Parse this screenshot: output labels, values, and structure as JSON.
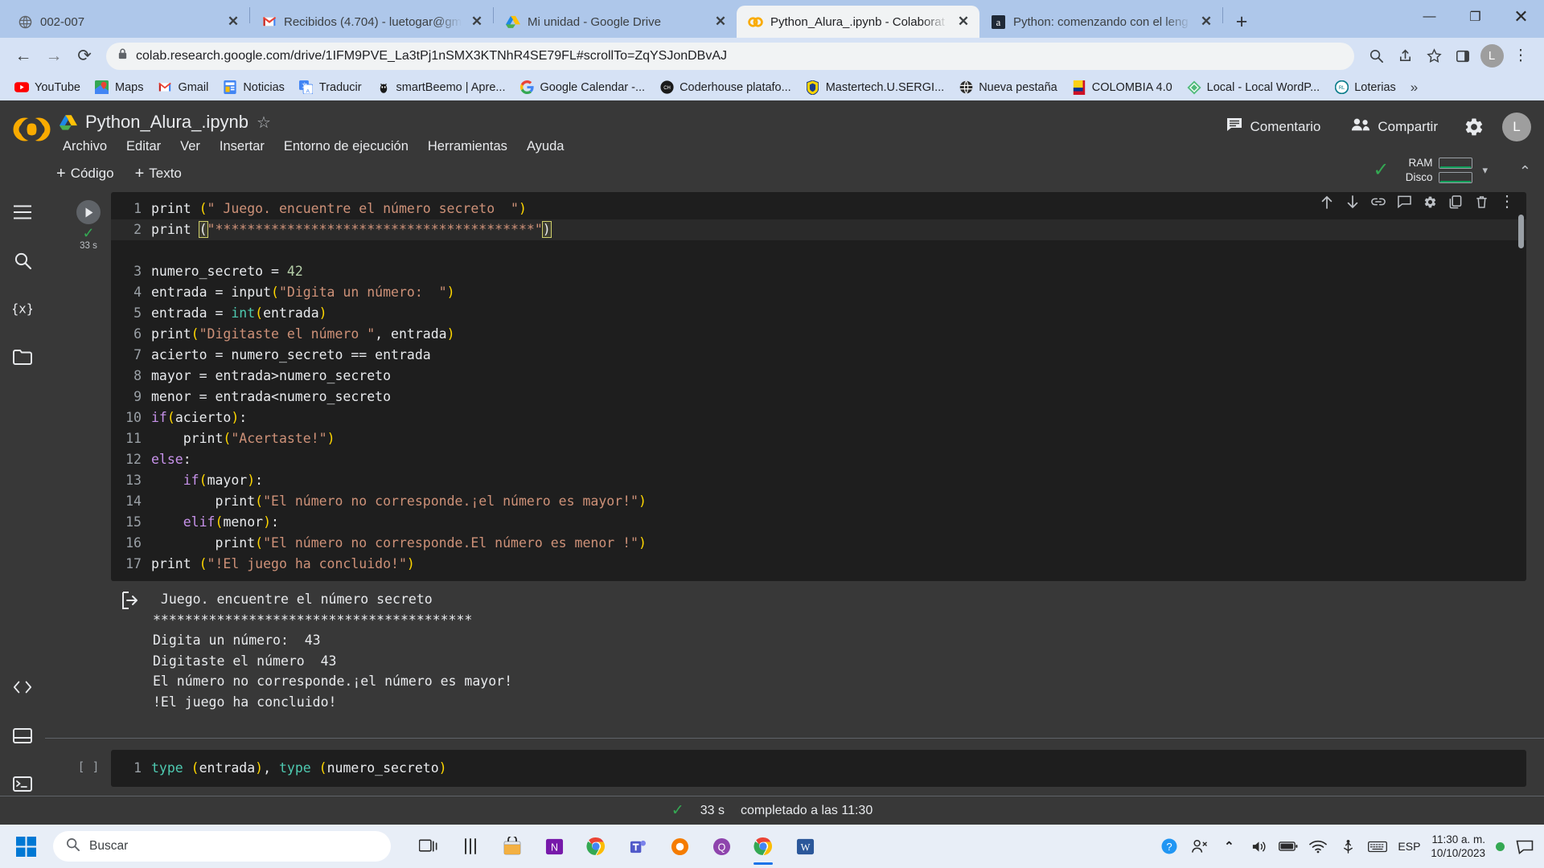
{
  "browser": {
    "tabs": [
      {
        "title": "002-007",
        "favicon": "globe-icon",
        "active": false
      },
      {
        "title": "Recibidos (4.704) - luetogar@gm",
        "favicon": "gmail-icon",
        "active": false
      },
      {
        "title": "Mi unidad - Google Drive",
        "favicon": "drive-icon",
        "active": false
      },
      {
        "title": "Python_Alura_.ipynb - Colaborat",
        "favicon": "colab-icon",
        "active": true
      },
      {
        "title": "Python: comenzando con el leng",
        "favicon": "alura-icon",
        "active": false
      }
    ],
    "tab_close_label": "✕",
    "new_tab_label": "+",
    "window_controls": {
      "minimize": "—",
      "maximize": "❐",
      "close": "✕"
    },
    "nav": {
      "back": "←",
      "forward": "→",
      "reload": "⟳"
    },
    "url": "colab.research.google.com/drive/1IFM9PVE_La3tPj1nSMX3KTNhR4SE79FL#scrollTo=ZqYSJonDBvAJ",
    "url_prefix": "colab.research.google.com",
    "url_rest": "/drive/1IFM9PVE_La3tPj1nSMX3KTNhR4SE79FL#scrollTo=ZqYSJonDBvAJ",
    "lock_icon": "lock-icon",
    "omni_right": {
      "zoom": "magnify-icon",
      "share": "share-icon",
      "star": "star-icon",
      "sidepanel": "side-panel-icon",
      "profile": "L",
      "menu": "⋮"
    },
    "bookmarks": [
      {
        "label": "YouTube",
        "icon": "youtube-icon"
      },
      {
        "label": "Maps",
        "icon": "maps-icon"
      },
      {
        "label": "Gmail",
        "icon": "gmail-icon"
      },
      {
        "label": "Noticias",
        "icon": "news-icon"
      },
      {
        "label": "Traducir",
        "icon": "translate-icon"
      },
      {
        "label": "smartBeemo | Apre...",
        "icon": "smartbeemo-icon"
      },
      {
        "label": "Google Calendar -...",
        "icon": "google-icon"
      },
      {
        "label": "Coderhouse platafo...",
        "icon": "coderhouse-icon"
      },
      {
        "label": "Mastertech.U.SERGI...",
        "icon": "mastertech-icon"
      },
      {
        "label": "Nueva pestaña",
        "icon": "globe-icon"
      },
      {
        "label": "COLOMBIA 4.0",
        "icon": "colombia-icon"
      },
      {
        "label": "Local - Local WordP...",
        "icon": "local-icon"
      },
      {
        "label": "Loterias",
        "icon": "loterias-icon"
      }
    ],
    "bookmarks_overflow": "»"
  },
  "colab": {
    "logo": "colab-logo",
    "drive_icon": "drive-icon",
    "notebook_title": "Python_Alura_.ipynb",
    "star_icon": "☆",
    "menus": [
      "Archivo",
      "Editar",
      "Ver",
      "Insertar",
      "Entorno de ejecución",
      "Herramientas",
      "Ayuda"
    ],
    "comment_button": "Comentario",
    "share_button": "Compartir",
    "settings_icon": "gear-icon",
    "account_initial": "L",
    "toolbar": {
      "add_code": "Código",
      "add_text": "Texto",
      "plus": "+"
    },
    "resources": {
      "check": "✓",
      "ram_label": "RAM",
      "disk_label": "Disco",
      "caret": "▾",
      "collapse": "⌃"
    },
    "rail_icons": [
      "menu-icon",
      "search-icon",
      "variables-icon",
      "files-icon"
    ],
    "rail_bottom_icons": [
      "code-snippets-icon",
      "terminal-pane-icon",
      "terminal-icon"
    ],
    "cell1": {
      "run_icon": "play-icon",
      "status_check": "✓",
      "exec_time": "33 s",
      "actions": [
        "move-up-icon",
        "move-down-icon",
        "link-icon",
        "comment-icon",
        "settings-icon",
        "copy-icon",
        "delete-icon",
        "more-icon"
      ],
      "lines": [
        {
          "n": "1",
          "tokens": [
            [
              "fn",
              "print "
            ],
            [
              "pa",
              "("
            ],
            [
              "st",
              "\" Juego. encuentre el número secreto  \""
            ],
            [
              "pa",
              ")"
            ]
          ]
        },
        {
          "n": "2",
          "highlight": true,
          "tokens": [
            [
              "fn",
              "print "
            ],
            [
              "brk",
              "("
            ],
            [
              "st",
              "\"****************************************\""
            ],
            [
              "brk",
              ")"
            ]
          ]
        },
        {
          "n": "3",
          "tokens": [
            [
              "op",
              "numero_secreto = "
            ],
            [
              "nu",
              "42"
            ]
          ]
        },
        {
          "n": "4",
          "tokens": [
            [
              "op",
              "entrada = "
            ],
            [
              "fn",
              "input"
            ],
            [
              "pa",
              "("
            ],
            [
              "st",
              "\"Digita un número:  \""
            ],
            [
              "pa",
              ")"
            ]
          ]
        },
        {
          "n": "5",
          "tokens": [
            [
              "op",
              "entrada = "
            ],
            [
              "bi",
              "int"
            ],
            [
              "pa",
              "("
            ],
            [
              "op",
              "entrada"
            ],
            [
              "pa",
              ")"
            ]
          ]
        },
        {
          "n": "6",
          "tokens": [
            [
              "fn",
              "print"
            ],
            [
              "pa",
              "("
            ],
            [
              "st",
              "\"Digitaste el número \""
            ],
            [
              "op",
              ", entrada"
            ],
            [
              "pa",
              ")"
            ]
          ]
        },
        {
          "n": "7",
          "tokens": [
            [
              "op",
              "acierto = numero_secreto == entrada"
            ]
          ]
        },
        {
          "n": "8",
          "tokens": [
            [
              "op",
              "mayor = entrada>numero_secreto"
            ]
          ]
        },
        {
          "n": "9",
          "tokens": [
            [
              "op",
              "menor = entrada<numero_secreto"
            ]
          ]
        },
        {
          "n": "10",
          "tokens": [
            [
              "k",
              "if"
            ],
            [
              "pa",
              "("
            ],
            [
              "op",
              "acierto"
            ],
            [
              "pa",
              ")"
            ],
            [
              "op",
              ":"
            ]
          ]
        },
        {
          "n": "11",
          "tokens": [
            [
              "op",
              "    "
            ],
            [
              "fn",
              "print"
            ],
            [
              "pa",
              "("
            ],
            [
              "st",
              "\"Acertaste!\""
            ],
            [
              "pa",
              ")"
            ]
          ]
        },
        {
          "n": "12",
          "tokens": [
            [
              "k",
              "else"
            ],
            [
              "op",
              ":"
            ]
          ]
        },
        {
          "n": "13",
          "tokens": [
            [
              "op",
              "    "
            ],
            [
              "k",
              "if"
            ],
            [
              "pa",
              "("
            ],
            [
              "op",
              "mayor"
            ],
            [
              "pa",
              ")"
            ],
            [
              "op",
              ":"
            ]
          ]
        },
        {
          "n": "14",
          "tokens": [
            [
              "op",
              "        "
            ],
            [
              "fn",
              "print"
            ],
            [
              "pa",
              "("
            ],
            [
              "st",
              "\"El número no corresponde.¡el número es mayor!\""
            ],
            [
              "pa",
              ")"
            ]
          ]
        },
        {
          "n": "15",
          "tokens": [
            [
              "op",
              "    "
            ],
            [
              "k",
              "elif"
            ],
            [
              "pa",
              "("
            ],
            [
              "op",
              "menor"
            ],
            [
              "pa",
              ")"
            ],
            [
              "op",
              ":"
            ]
          ]
        },
        {
          "n": "16",
          "tokens": [
            [
              "op",
              "        "
            ],
            [
              "fn",
              "print"
            ],
            [
              "pa",
              "("
            ],
            [
              "st",
              "\"El número no corresponde.El número es menor !\""
            ],
            [
              "pa",
              ")"
            ]
          ]
        },
        {
          "n": "17",
          "tokens": [
            [
              "fn",
              "print "
            ],
            [
              "pa",
              "("
            ],
            [
              "st",
              "\"!El juego ha concluido!\""
            ],
            [
              "pa",
              ")"
            ]
          ]
        }
      ],
      "output_icon": "output-arrow-icon",
      "output": " Juego. encuentre el número secreto\n****************************************\nDigita un número:  43\nDigitaste el número  43\nEl número no corresponde.¡el número es mayor!\n!El juego ha concluido!"
    },
    "cell2": {
      "prompt": "[ ]",
      "lines": [
        {
          "n": "1",
          "tokens": [
            [
              "bi",
              "type "
            ],
            [
              "pa",
              "("
            ],
            [
              "op",
              "entrada"
            ],
            [
              "pa",
              ")"
            ],
            [
              "op",
              ", "
            ],
            [
              "bi",
              "type "
            ],
            [
              "pa",
              "("
            ],
            [
              "op",
              "numero_secreto"
            ],
            [
              "pa",
              ")"
            ]
          ]
        }
      ]
    },
    "status": {
      "check": "✓",
      "duration": "33 s",
      "message": "completado a las 11:30"
    }
  },
  "taskbar": {
    "start_icon": "windows-icon",
    "search_placeholder": "Buscar",
    "search_icon": "search-icon",
    "icons": [
      {
        "name": "task-view-icon",
        "active": false
      },
      {
        "name": "widgets-icon",
        "active": false
      },
      {
        "name": "store-icon",
        "active": false
      },
      {
        "name": "onenote-icon",
        "active": false
      },
      {
        "name": "chrome-icon",
        "active": false
      },
      {
        "name": "teams-icon",
        "active": false
      },
      {
        "name": "handbrake-icon",
        "active": false
      },
      {
        "name": "q-app-icon",
        "active": false
      },
      {
        "name": "chrome-active-icon",
        "active": true
      },
      {
        "name": "word-icon",
        "active": false
      }
    ],
    "tray": {
      "help_icon": "help-icon",
      "people_icon": "people-icon",
      "chevron_icon": "⌃",
      "volume_icon": "volume-icon",
      "battery_icon": "battery-icon",
      "wifi_icon": "wifi-icon",
      "usb_icon": "usb-icon",
      "keyboard_icon": "keyboard-icon",
      "language": "ESP",
      "time": "11:30 a. m.",
      "date": "10/10/2023",
      "notification_icon": "notification-icon"
    }
  },
  "colors": {
    "chrome_tabstrip": "#aec7ea",
    "chrome_toolbar": "#d6e2f5",
    "colab_bg": "#383838",
    "code_bg": "#1e1e1e",
    "accent_green": "#34a853",
    "colab_orange": "#f9ab00"
  }
}
